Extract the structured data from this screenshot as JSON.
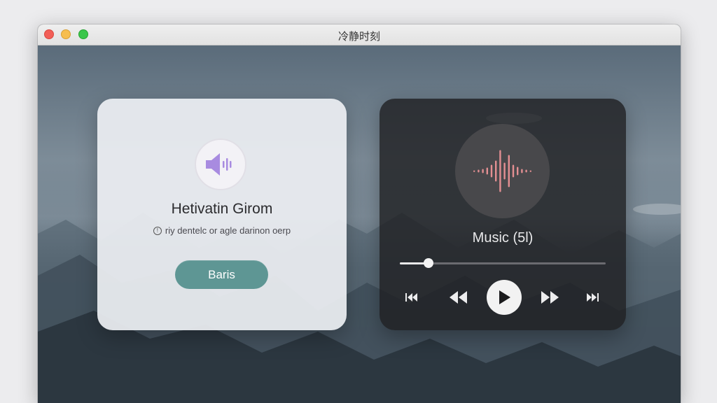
{
  "window": {
    "title": "冷静时刻"
  },
  "left_card": {
    "icon": "speaker-icon",
    "title": "Hetivatin Girom",
    "subtitle": "riy dentelc or agle darinon oerp",
    "button_label": "Baris",
    "accent_color": "#5e9694",
    "icon_color": "#a88be0"
  },
  "player": {
    "icon": "audio-waveform-icon",
    "track_title": "Music (5l)",
    "progress_fraction": 0.14,
    "waveform_color": "#e38f92",
    "controls": {
      "skip_back": "skip-to-start-icon",
      "rewind": "rewind-icon",
      "play": "play-icon",
      "fast_forward": "fast-forward-icon",
      "skip_forward": "skip-to-end-icon"
    }
  }
}
